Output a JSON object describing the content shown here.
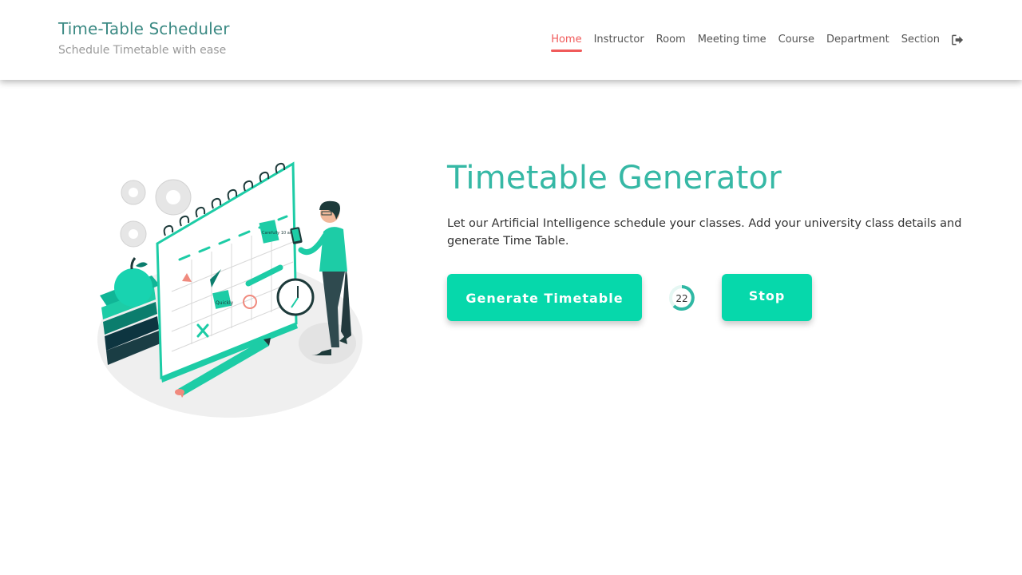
{
  "header": {
    "title": "Time-Table Scheduler",
    "subtitle": "Schedule Timetable with ease",
    "nav": [
      {
        "label": "Home",
        "active": true
      },
      {
        "label": "Instructor"
      },
      {
        "label": "Room"
      },
      {
        "label": "Meeting time"
      },
      {
        "label": "Course"
      },
      {
        "label": "Department"
      },
      {
        "label": "Section"
      }
    ],
    "logout_icon": "sign-out-icon"
  },
  "hero": {
    "title": "Timetable Generator",
    "description": "Let our Artificial Intelligence schedule your classes. Add your university class details and generate Time Table.",
    "generate_label": "Generate Timetable",
    "stop_label": "Stop",
    "progress_count": "22",
    "illustration_notes": {
      "note1": "Quickly",
      "note2": "Carefully 10 am"
    }
  },
  "colors": {
    "accent": "#06d8ab",
    "title": "#36b8a5",
    "brand": "#3c8a84",
    "active_nav": "#f05a5a"
  }
}
